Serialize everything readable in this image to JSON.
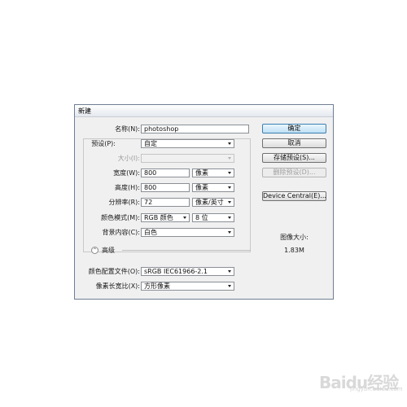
{
  "dialog": {
    "title": "新建"
  },
  "form": {
    "name": {
      "label": "名称(N):",
      "value": "photoshop"
    },
    "preset": {
      "label": "预设(P):",
      "value": "自定"
    },
    "size": {
      "label": "大小(I):",
      "value": ""
    },
    "width": {
      "label": "宽度(W):",
      "value": "800",
      "unit": "像素"
    },
    "height": {
      "label": "高度(H):",
      "value": "800",
      "unit": "像素"
    },
    "resolution": {
      "label": "分辨率(R):",
      "value": "72",
      "unit": "像素/英寸"
    },
    "color_mode": {
      "label": "颜色模式(M):",
      "value": "RGB 颜色",
      "depth": "8 位"
    },
    "background": {
      "label": "背景内容(C):",
      "value": "白色"
    },
    "advanced": {
      "label": "高级",
      "toggle_glyph": "⌃"
    },
    "color_profile": {
      "label": "颜色配置文件(O):",
      "value": "sRGB IEC61966-2.1"
    },
    "pixel_aspect": {
      "label": "像素长宽比(X):",
      "value": "方形像素"
    }
  },
  "buttons": {
    "ok": "确定",
    "cancel": "取消",
    "save_preset": "存储预设(S)...",
    "delete_preset": "删除预设(D)...",
    "device_central": "Device Central(E)..."
  },
  "image_size": {
    "label": "图像大小:",
    "value": "1.83M"
  },
  "watermark": {
    "brand": "Baidu经验",
    "url": "jingyan.baidu.com"
  }
}
